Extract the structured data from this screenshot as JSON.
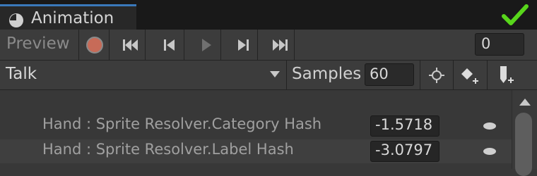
{
  "window": {
    "tab_title": "Animation",
    "tab_icon": "animation-clock-icon",
    "status_icon": "green-check-icon"
  },
  "toolbar": {
    "preview_label": "Preview",
    "buttons": [
      "record-icon",
      "first-keyframe-icon",
      "previous-keyframe-icon",
      "play-icon",
      "next-keyframe-icon",
      "last-keyframe-icon"
    ],
    "frame_value": "0"
  },
  "clip_bar": {
    "clip_name": "Talk",
    "samples_label": "Samples",
    "samples_value": "60",
    "buttons": [
      "filter-by-selection-icon",
      "add-keyframe-icon",
      "add-event-icon"
    ]
  },
  "properties": [
    {
      "name": "Hand : Sprite Resolver.Category Hash",
      "value": "-1.5718"
    },
    {
      "name": "Hand : Sprite Resolver.Label Hash",
      "value": "-3.0797"
    }
  ],
  "colors": {
    "accent_blue": "#3a79bb",
    "record_red": "#c76b58",
    "check_green": "#58d61b"
  }
}
